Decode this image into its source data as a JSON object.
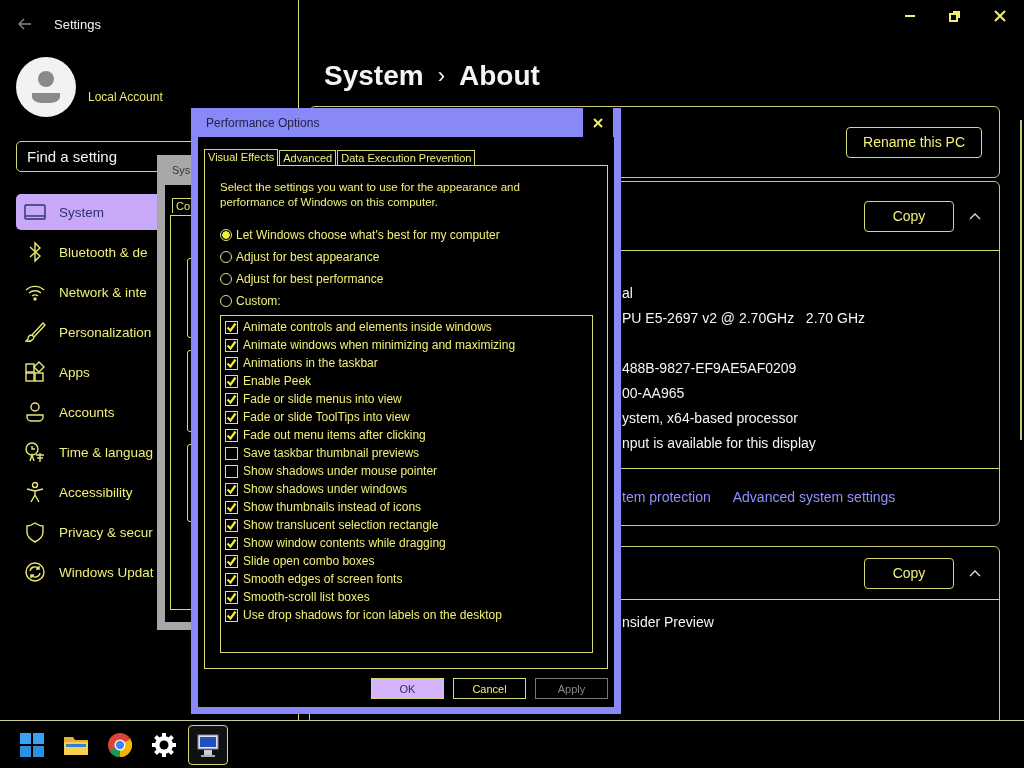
{
  "settings": {
    "title": "Settings",
    "account": "Local Account",
    "search": {
      "placeholder": "Find a setting"
    },
    "nav": [
      {
        "label": "System",
        "selected": true
      },
      {
        "label": "Bluetooth & de",
        "selected": false
      },
      {
        "label": "Network & inte",
        "selected": false
      },
      {
        "label": "Personalization",
        "selected": false
      },
      {
        "label": "Apps",
        "selected": false
      },
      {
        "label": "Accounts",
        "selected": false
      },
      {
        "label": "Time & languag",
        "selected": false
      },
      {
        "label": "Accessibility",
        "selected": false
      },
      {
        "label": "Privacy & secur",
        "selected": false
      },
      {
        "label": "Windows Updat",
        "selected": false
      }
    ],
    "breadcrumb": {
      "parent": "System",
      "separator": "›",
      "current": "About"
    },
    "device_card": {
      "button": "Rename this PC"
    },
    "specs_card": {
      "button": "Copy",
      "expanded": true,
      "rows": [
        "al",
        "PU E5-2697 v2 @ 2.70GHz   2.70 GHz",
        "488B-9827-EF9AE5AF0209",
        "00-AA965",
        "ystem, x64-based processor",
        "nput is available for this display"
      ],
      "links": [
        "tem protection",
        "Advanced system settings"
      ]
    },
    "windows_card": {
      "button": "Copy",
      "expanded": true,
      "rows": [
        "nsider Preview"
      ]
    }
  },
  "system_properties": {
    "title": "Sys",
    "tab": "Co"
  },
  "dialog": {
    "title": "Performance Options",
    "tabs": [
      {
        "label": "Visual Effects",
        "selected": true
      },
      {
        "label": "Advanced",
        "selected": false
      },
      {
        "label": "Data Execution Prevention",
        "selected": false
      }
    ],
    "description": "Select the settings you want to use for the appearance and performance of Windows on this computer.",
    "options": [
      {
        "label": "Let Windows choose what's best for my computer",
        "selected": true
      },
      {
        "label": "Adjust for best appearance",
        "selected": false
      },
      {
        "label": "Adjust for best performance",
        "selected": false
      },
      {
        "label": "Custom:",
        "selected": false
      }
    ],
    "effects": [
      {
        "label": "Animate controls and elements inside windows",
        "checked": true
      },
      {
        "label": "Animate windows when minimizing and maximizing",
        "checked": true
      },
      {
        "label": "Animations in the taskbar",
        "checked": true
      },
      {
        "label": "Enable Peek",
        "checked": true
      },
      {
        "label": "Fade or slide menus into view",
        "checked": true
      },
      {
        "label": "Fade or slide ToolTips into view",
        "checked": true
      },
      {
        "label": "Fade out menu items after clicking",
        "checked": true
      },
      {
        "label": "Save taskbar thumbnail previews",
        "checked": false
      },
      {
        "label": "Show shadows under mouse pointer",
        "checked": false
      },
      {
        "label": "Show shadows under windows",
        "checked": true
      },
      {
        "label": "Show thumbnails instead of icons",
        "checked": true
      },
      {
        "label": "Show translucent selection rectangle",
        "checked": true
      },
      {
        "label": "Show window contents while dragging",
        "checked": true
      },
      {
        "label": "Slide open combo boxes",
        "checked": true
      },
      {
        "label": "Smooth edges of screen fonts",
        "checked": true
      },
      {
        "label": "Smooth-scroll list boxes",
        "checked": true
      },
      {
        "label": "Use drop shadows for icon labels on the desktop",
        "checked": true
      }
    ],
    "buttons": [
      {
        "label": "OK",
        "kind": "default",
        "disabled": false
      },
      {
        "label": "Cancel",
        "kind": "normal",
        "disabled": false
      },
      {
        "label": "Apply",
        "kind": "normal",
        "disabled": true
      }
    ]
  },
  "taskbar": {
    "apps": [
      {
        "selected": false
      },
      {
        "selected": false
      },
      {
        "selected": false
      },
      {
        "selected": false
      },
      {
        "selected": true
      }
    ]
  }
}
